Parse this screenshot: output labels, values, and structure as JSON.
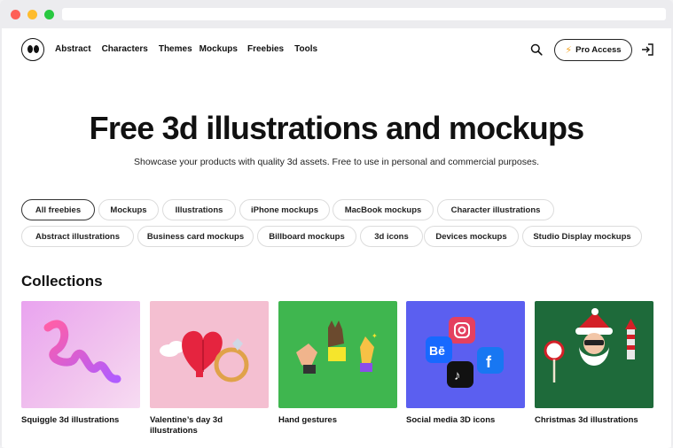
{
  "nav": {
    "items": [
      "Abstract",
      "Characters",
      "Themes",
      "Mockups",
      "Freebies",
      "Tools"
    ],
    "pro_label": "Pro Access"
  },
  "hero": {
    "title": "Free 3d illustrations and mockups",
    "subtitle": "Showcase your products with quality 3d assets. Free to use in personal and commercial purposes."
  },
  "filters": {
    "row1": [
      "All freebies",
      "Mockups",
      "Illustrations",
      "iPhone mockups",
      "MacBook mockups",
      "Character illustrations"
    ],
    "row2": [
      "Abstract illustrations",
      "Business card mockups",
      "Billboard mockups",
      "3d icons",
      "Devices mockups",
      "Studio Display mockups"
    ],
    "active": "All freebies"
  },
  "collections": {
    "title": "Collections",
    "cards": [
      {
        "caption": "Squiggle 3d illustrations",
        "bg": "#e6b3ee",
        "icon": "squiggle-illustration-image"
      },
      {
        "caption": "Valentine’s day 3d illustrations",
        "bg": "#f2bfd0",
        "icon": "valentine-heart-ring-image"
      },
      {
        "caption": "Hand gestures",
        "bg": "#3db84e",
        "icon": "hand-gestures-image"
      },
      {
        "caption": "Social media 3D icons",
        "bg": "#5a5ef0",
        "icon": "social-media-icons-image"
      },
      {
        "caption": "Christmas 3d illustrations",
        "bg": "#1f6b3a",
        "icon": "santa-christmas-image"
      }
    ]
  }
}
